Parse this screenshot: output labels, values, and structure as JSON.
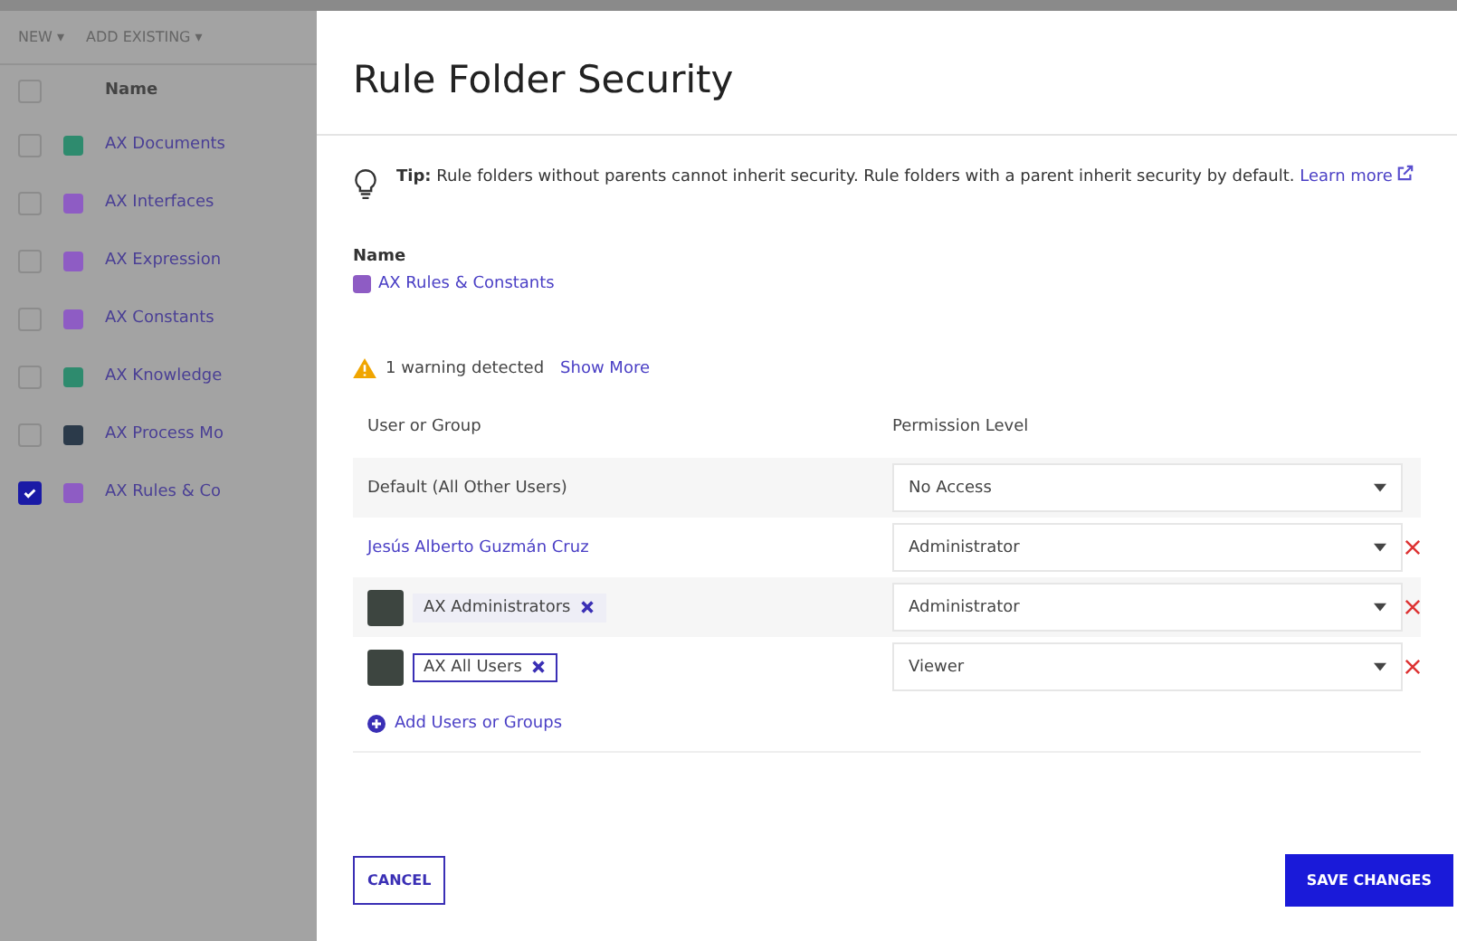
{
  "background": {
    "toolbar": [
      "NEW ▾",
      "ADD EXISTING ▾"
    ],
    "column": "Name",
    "header_checked": false,
    "rows": [
      {
        "name": "AX Documents",
        "color": "#2e8b6e",
        "checked": false
      },
      {
        "name": "AX Interfaces",
        "color": "#8e5cc4",
        "checked": false
      },
      {
        "name": "AX Expression",
        "color": "#8e5cc4",
        "checked": false
      },
      {
        "name": "AX Constants",
        "color": "#8e5cc4",
        "checked": false
      },
      {
        "name": "AX Knowledge",
        "color": "#2e8b6e",
        "checked": false
      },
      {
        "name": "AX Process Mo",
        "color": "#2b3a4a",
        "checked": false
      },
      {
        "name": "AX Rules & Co",
        "color": "#8e5cc4",
        "checked": true
      }
    ]
  },
  "dialog": {
    "title": "Rule Folder Security",
    "tip": {
      "text": "**Tip:** Rule folders without parents cannot inherit security. Rule folders with a parent inherit security by default.",
      "link": "Learn more"
    },
    "name_label": "Name",
    "name_value": "AX Rules & Constants",
    "warning": {
      "text": "1 warning detected",
      "link": "Show More"
    },
    "columns": [
      "User or Group",
      "Permission Level"
    ],
    "rows": [
      {
        "kind": "default",
        "name": "Default (All Other Users)",
        "permission": "No Access"
      },
      {
        "kind": "user",
        "name": "Jesús Alberto Guzmán Cruz",
        "permission": "Administrator"
      },
      {
        "kind": "group",
        "name": "AX Administrators",
        "permission": "Administrator"
      },
      {
        "kind": "group",
        "name": "AX All Users",
        "permission": "Viewer"
      }
    ],
    "add_link": "Add Users or Groups",
    "buttons": {
      "cancel": "CANCEL",
      "save": "SAVE CHANGES"
    }
  }
}
